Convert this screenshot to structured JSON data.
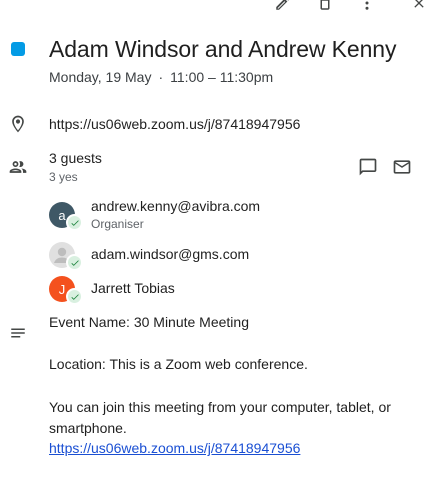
{
  "toolbar": {
    "edit_icon": "pencil-icon",
    "delete_icon": "trash-icon",
    "more_icon": "more-vert-icon",
    "close_icon": "close-icon"
  },
  "event": {
    "color": "#039be5",
    "title": "Adam Windsor and Andrew Kenny",
    "date": "Monday, 19 May",
    "separator": "·",
    "time": "11:00 – 11:30pm"
  },
  "location": {
    "icon": "location-pin-icon",
    "text": "https://us06web.zoom.us/j/87418947956"
  },
  "guests": {
    "icon": "people-icon",
    "count_label": "3 guests",
    "summary": "3 yes",
    "chat_icon": "chat-icon",
    "email_icon": "mail-icon",
    "list": [
      {
        "name": "andrew.kenny@avibra.com",
        "role": "Organiser",
        "initial": "a",
        "avatar_color": "#3f5866"
      },
      {
        "name": "adam.windsor@gms.com",
        "role": "",
        "initial": "",
        "avatar_color": "#e0e0e0"
      },
      {
        "name": "Jarrett Tobias",
        "role": "",
        "initial": "J",
        "avatar_color": "#f4511e"
      }
    ]
  },
  "description": {
    "icon": "notes-icon",
    "event_name": "Event Name: 30 Minute Meeting",
    "location_line": "Location: This is a Zoom web conference.",
    "join_text": "You can join this meeting from your computer, tablet, or smartphone.",
    "link": "https://us06web.zoom.us/j/87418947956"
  }
}
